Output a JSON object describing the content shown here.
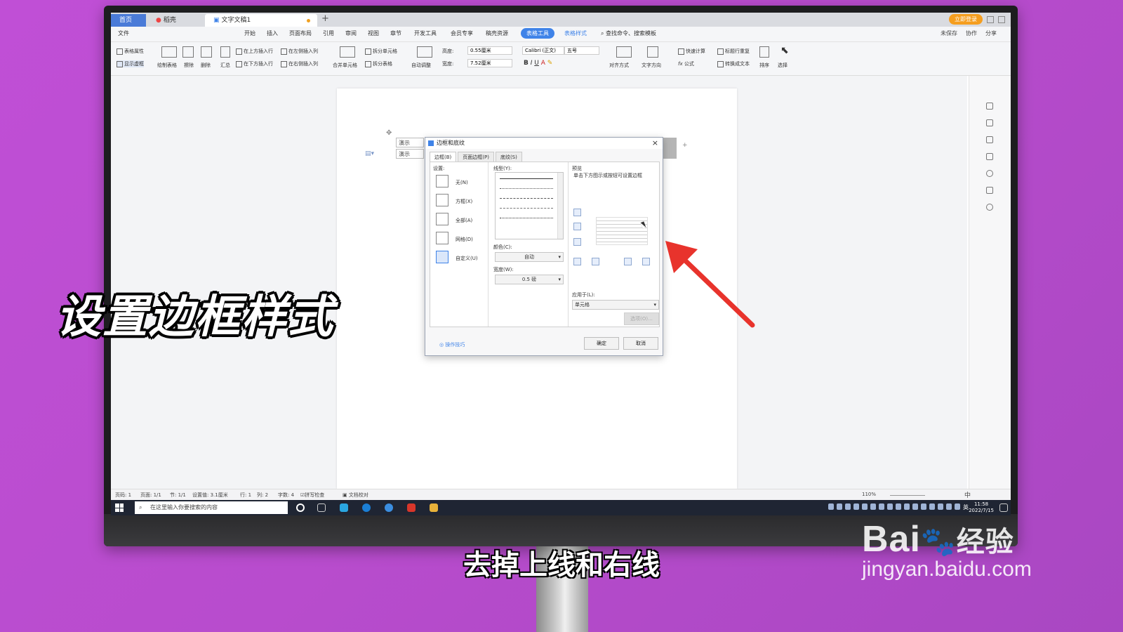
{
  "tabs": {
    "home": "首页",
    "dao": "稻壳",
    "doc": "文字文稿1",
    "login": "立即登录"
  },
  "menu": {
    "file": "文件",
    "items": [
      "开始",
      "插入",
      "页面布局",
      "引用",
      "审阅",
      "视图",
      "章节",
      "开发工具",
      "会员专享",
      "稿壳资源"
    ],
    "active": "表格工具",
    "style": "表格样式",
    "search": "查找命令、搜索模板",
    "unsaved": "未保存",
    "collab": "协作",
    "share": "分享"
  },
  "ribbon": {
    "table_props": "表格属性",
    "show_grid": "显示虚框",
    "draw": "绘制表格",
    "erase": "擦除",
    "delete": "删除",
    "sum": "汇总",
    "ins_above": "在上方插入行",
    "ins_below": "在下方插入行",
    "ins_left": "在左侧插入列",
    "ins_right": "在右侧插入列",
    "merge": "合并单元格",
    "split_cell": "拆分单元格",
    "split_table": "拆分表格",
    "autofit": "自动调整",
    "height_label": "高度:",
    "height_val": "0.55厘米",
    "width_label": "宽度:",
    "width_val": "7.52厘米",
    "font": "Calibri (正文)",
    "size": "五号",
    "align": "对齐方式",
    "direction": "文字方向",
    "calc": "快速计算",
    "header_repeat": "标题行重复",
    "to_text": "转换成文本",
    "formula": "公式",
    "sort": "排序",
    "select": "选择"
  },
  "document": {
    "cells": [
      "演示",
      "演示"
    ]
  },
  "dialog": {
    "title": "边框和底纹",
    "tabs": [
      "边框(B)",
      "页面边框(P)",
      "底纹(S)"
    ],
    "setting_label": "设置:",
    "settings": [
      "无(N)",
      "方框(X)",
      "全部(A)",
      "网格(D)",
      "自定义(U)"
    ],
    "line_label": "线型(Y):",
    "color_label": "颜色(C):",
    "color_value": "自动",
    "width_label": "宽度(W):",
    "width_value": "0.5 磅",
    "preview_label": "预览",
    "preview_hint": "单击下方图示或按钮可设置边框",
    "apply_label": "应用于(L):",
    "apply_value": "单元格",
    "options": "选项(O)...",
    "tips": "操作技巧",
    "ok": "确定",
    "cancel": "取消"
  },
  "status": {
    "page": "页码: 1",
    "pages": "页面: 1/1",
    "section": "节: 1/1",
    "setting": "设置值: 3.1厘米",
    "row": "行: 1",
    "col": "列: 2",
    "words": "字数: 4",
    "spell": "拼写检查",
    "proof": "文档校对",
    "zoom": "110%"
  },
  "taskbar": {
    "search_placeholder": "在这里输入你要搜索的内容",
    "time": "11:58",
    "date": "2022/7/15",
    "ime": "中",
    "lang": "英"
  },
  "overlay": {
    "caption": "设置边框样式",
    "subtitle": "去掉上线和右线"
  },
  "watermark": {
    "brand": "Bai",
    "brand_cn": "经验",
    "url": "jingyan.baidu.com"
  },
  "colors": {
    "accent": "#3f83e8",
    "background": "#b84ccd",
    "arrow": "#e8332c"
  }
}
